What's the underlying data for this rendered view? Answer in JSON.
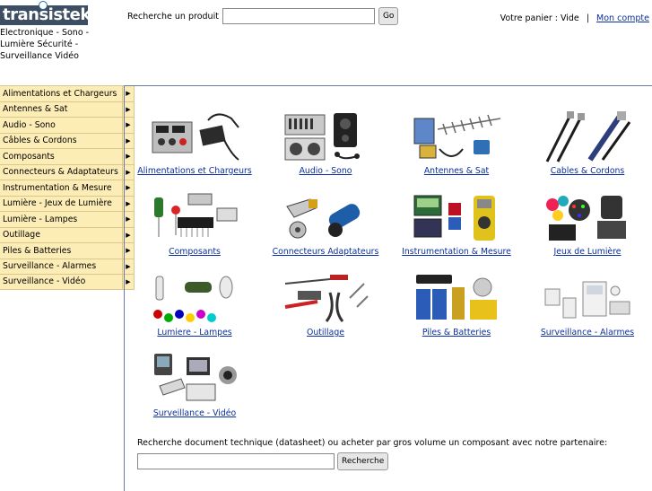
{
  "logo": {
    "text": "transistek"
  },
  "tagline": "Electronique - Sono - Lumière Sécurité - Surveillance Vidéo",
  "search": {
    "label": "Recherche un produit",
    "placeholder": "",
    "value": "",
    "button": "Go"
  },
  "cart": {
    "status": "Votre panier : Vide",
    "separator": "|",
    "account": "Mon compte"
  },
  "sidebar": {
    "items": [
      {
        "label": "Alimentations et Chargeurs"
      },
      {
        "label": "Antennes & Sat"
      },
      {
        "label": "Audio - Sono"
      },
      {
        "label": "Câbles & Cordons"
      },
      {
        "label": "Composants"
      },
      {
        "label": "Connecteurs & Adaptateurs"
      },
      {
        "label": "Instrumentation & Mesure"
      },
      {
        "label": "Lumière - Jeux de Lumière"
      },
      {
        "label": "Lumière - Lampes"
      },
      {
        "label": "Outillage"
      },
      {
        "label": "Piles & Batteries"
      },
      {
        "label": "Surveillance - Alarmes"
      },
      {
        "label": "Surveillance - Vidéo"
      }
    ],
    "arrow": "▶"
  },
  "categories": [
    {
      "label": "Alimentations et Chargeurs"
    },
    {
      "label": "Audio - Sono"
    },
    {
      "label": "Antennes & Sat"
    },
    {
      "label": "Cables & Cordons"
    },
    {
      "label": "Composants"
    },
    {
      "label": "Connecteurs Adaptateurs"
    },
    {
      "label": "Instrumentation & Mesure"
    },
    {
      "label": "Jeux de Lumière"
    },
    {
      "label": "Lumiere - Lampes"
    },
    {
      "label": "Outillage"
    },
    {
      "label": "Piles & Batteries"
    },
    {
      "label": "Surveillance - Alarmes"
    },
    {
      "label": "Surveillance - Vidéo"
    }
  ],
  "datasheet": {
    "text": "Recherche document technique (datasheet) ou acheter par gros volume un composant avec notre partenaire:",
    "value": "",
    "button": "Recherche"
  }
}
